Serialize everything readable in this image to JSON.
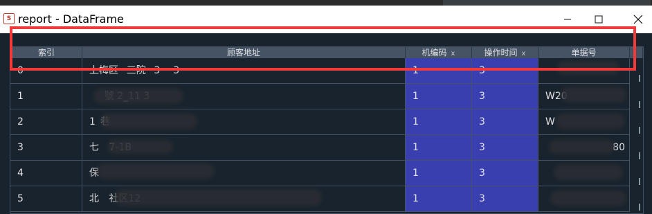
{
  "window": {
    "title": "report - DataFrame",
    "icon": "spyder-dataframe-icon",
    "controls": [
      "minimize",
      "maximize",
      "close"
    ]
  },
  "table": {
    "columns": [
      {
        "label": "索引",
        "sort": ""
      },
      {
        "label": "顾客地址",
        "sort": ""
      },
      {
        "label": "机编码",
        "sort": "x"
      },
      {
        "label": "操作时间",
        "sort": "x"
      },
      {
        "label": "单据号",
        "sort": ""
      }
    ],
    "rows": [
      {
        "index": "0",
        "address": "上梅区   三院   3     3",
        "machine": "1",
        "time": "3",
        "doc": ""
      },
      {
        "index": "1",
        "address": "      號 2_11 3",
        "machine": "1",
        "time": "3",
        "doc": "W20"
      },
      {
        "index": "2",
        "address": "1  巷",
        "machine": "1",
        "time": "3",
        "doc": "W"
      },
      {
        "index": "3",
        "address": "七    7-1B",
        "machine": "1",
        "time": "3",
        "doc": "80"
      },
      {
        "index": "4",
        "address": "保",
        "machine": "1",
        "time": "3",
        "doc": ""
      },
      {
        "index": "5",
        "address": "北    社区12",
        "machine": "1",
        "time": "3",
        "doc": ""
      }
    ]
  },
  "colors": {
    "background": "#19232d",
    "header": "#455364",
    "selected": "#3a3fb0",
    "highlight_box": "#f23a3a"
  }
}
